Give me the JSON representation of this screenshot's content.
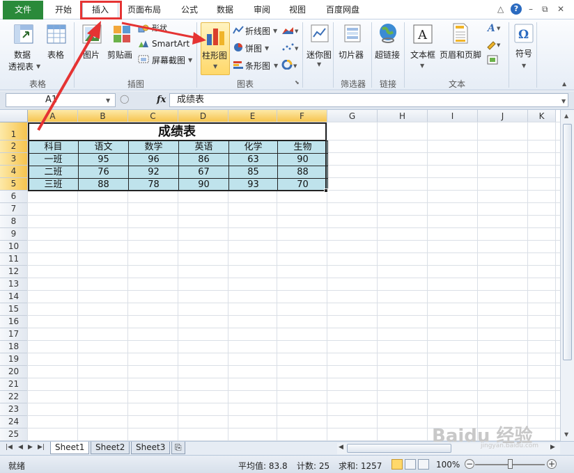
{
  "tabs": [
    "文件",
    "开始",
    "插入",
    "页面布局",
    "公式",
    "数据",
    "审阅",
    "视图",
    "百度网盘"
  ],
  "window_controls": {
    "minimize_ribbon": "△",
    "help": "?",
    "minimize": "–",
    "restore": "⧉",
    "close": "✕"
  },
  "ribbon": {
    "tables": {
      "pivot": "数据\n透视表",
      "pivot_l1": "数据",
      "pivot_l2": "透视表",
      "table": "表格",
      "label": "表格"
    },
    "illustrations": {
      "picture": "图片",
      "clipart": "剪贴画",
      "shapes": "形状",
      "smartart": "SmartArt",
      "screenshot": "屏幕截图",
      "label": "插图"
    },
    "charts": {
      "column": "柱形图",
      "line": "折线图",
      "pie": "饼图",
      "bar": "条形图",
      "label": "图表"
    },
    "sparklines": {
      "sparkline": "迷你图"
    },
    "filter": {
      "slicer": "切片器",
      "label": "筛选器"
    },
    "links": {
      "hyperlink": "超链接",
      "label": "链接"
    },
    "text": {
      "textbox": "文本框",
      "header_footer": "页眉和页脚",
      "label": "文本"
    },
    "symbols": {
      "symbol": "符号"
    }
  },
  "formula_bar": {
    "name_box": "A1",
    "fx": "fx",
    "formula": "成绩表"
  },
  "columns": [
    "A",
    "B",
    "C",
    "D",
    "E",
    "F",
    "G",
    "H",
    "I",
    "J",
    "K"
  ],
  "rows": [
    "1",
    "2",
    "3",
    "4",
    "5",
    "6",
    "7",
    "8",
    "9",
    "10",
    "11",
    "12",
    "13",
    "14",
    "15",
    "16",
    "17",
    "18",
    "19",
    "20",
    "21",
    "22",
    "23",
    "24",
    "25"
  ],
  "table": {
    "title": "成绩表",
    "headers": [
      "科目",
      "语文",
      "数学",
      "英语",
      "化学",
      "生物"
    ],
    "rows": [
      [
        "一班",
        "95",
        "96",
        "86",
        "63",
        "90"
      ],
      [
        "二班",
        "76",
        "92",
        "67",
        "85",
        "88"
      ],
      [
        "三班",
        "88",
        "78",
        "90",
        "93",
        "70"
      ]
    ]
  },
  "sheets": [
    "Sheet1",
    "Sheet2",
    "Sheet3"
  ],
  "status": {
    "ready": "就绪",
    "average": "平均值: 83.8",
    "count": "计数: 25",
    "sum": "求和: 1257",
    "zoom": "100%"
  },
  "watermark": {
    "brand": "Baidu 经验",
    "url": "jingyan.baidu.com"
  },
  "colors": {
    "file_tab": "#2a8a3a",
    "table_fill": "#bfe3ec",
    "highlight": "#e53333",
    "selected_header": "#f6c44e"
  }
}
